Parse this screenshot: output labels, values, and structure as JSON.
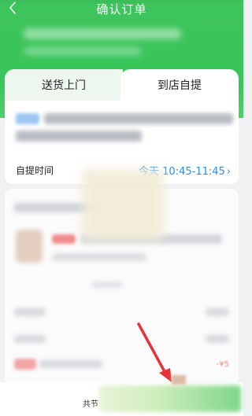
{
  "header": {
    "title": "确认订单",
    "back_icon": "chevron-left-icon"
  },
  "tabs": [
    {
      "label": "送货上门",
      "selected": false
    },
    {
      "label": "到店自提",
      "selected": true
    }
  ],
  "pickup": {
    "time_label": "自提时间",
    "time_value": "今天 10:45-11:45",
    "chevron": "›"
  },
  "order": {
    "promo_value": "-¥5"
  },
  "bottom_bar": {
    "total_label": "共节"
  },
  "colors": {
    "brand_green": "#3fc45c",
    "time_blue": "#2b8dea",
    "arrow_red": "#e8323a"
  }
}
